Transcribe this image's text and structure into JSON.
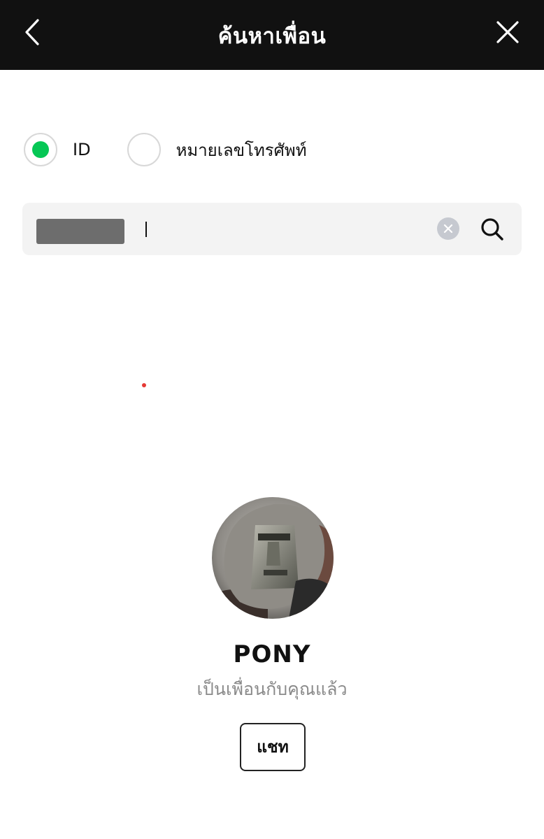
{
  "header": {
    "title": "ค้นหาเพื่อน",
    "back_icon": "chevron-left-icon",
    "close_icon": "close-icon",
    "background_color": "#111111"
  },
  "search_type": {
    "options": [
      {
        "label": "ID",
        "selected": true
      },
      {
        "label": "หมายเลขโทรศัพท์",
        "selected": false
      }
    ],
    "accent_color": "#06c755"
  },
  "search": {
    "clear_icon": "clear-icon",
    "search_icon": "search-icon"
  },
  "result": {
    "name": "PONY",
    "status": "เป็นเพื่อนกับคุณแล้ว",
    "chat_button_label": "แชท"
  }
}
